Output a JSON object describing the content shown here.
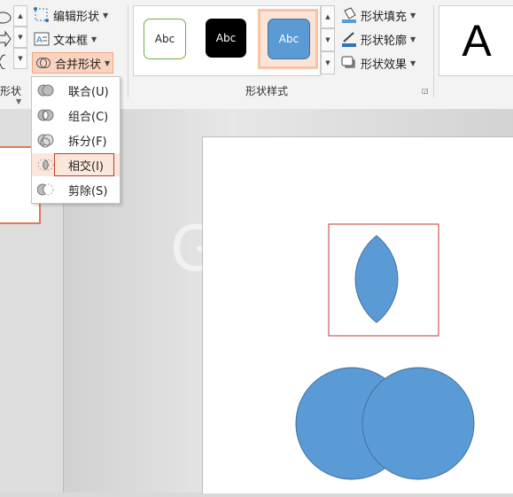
{
  "ribbon": {
    "insert_shapes_group_label": "形状",
    "edit_shape_label": "编辑形状",
    "text_box_label": "文本框",
    "merge_shapes_label": "合并形状",
    "shape_styles_group_label": "形状样式",
    "style_sample_text": "Abc",
    "shape_fill_label": "形状填充",
    "shape_outline_label": "形状轮廓",
    "shape_effects_label": "形状效果",
    "wordart_letter": "A"
  },
  "merge_menu": {
    "items": [
      {
        "label": "联合(U)",
        "icon": "union-icon"
      },
      {
        "label": "组合(C)",
        "icon": "combine-icon"
      },
      {
        "label": "拆分(F)",
        "icon": "fragment-icon"
      },
      {
        "label": "相交(I)",
        "icon": "intersect-icon",
        "highlighted": true
      },
      {
        "label": "剪除(S)",
        "icon": "subtract-icon"
      }
    ]
  },
  "colors": {
    "accent": "#f0a77f",
    "shape_fill": "#5b9bd5",
    "shape_stroke": "#41719c",
    "annotation_red": "#c0392b"
  }
}
